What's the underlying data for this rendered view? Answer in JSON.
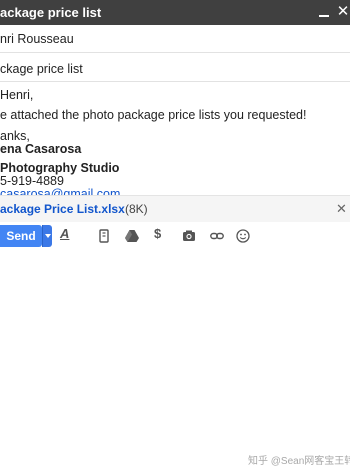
{
  "window": {
    "title": "ackage price list"
  },
  "compose": {
    "to_value": "nri Rousseau",
    "subject_value": "ckage price list"
  },
  "body": {
    "greeting": "Henri,",
    "text": "e attached the photo package price lists you requested!",
    "thanks": "anks,",
    "sender_name": "ena Casarosa",
    "studio": "Photography Studio",
    "phone": "5-919-4889",
    "email": "casarosa@gmail.com"
  },
  "attachment": {
    "name": "ackage Price List.xlsx",
    "size": "(8K)",
    "close": "✕"
  },
  "toolbar": {
    "send_label": "Send",
    "icons": [
      "formatting-icon",
      "attach-file-icon",
      "drive-icon",
      "dollar-icon",
      "insert-photo-icon",
      "insert-link-icon",
      "emoji-icon"
    ]
  },
  "watermark": "知乎 @Sean网客宝王转"
}
